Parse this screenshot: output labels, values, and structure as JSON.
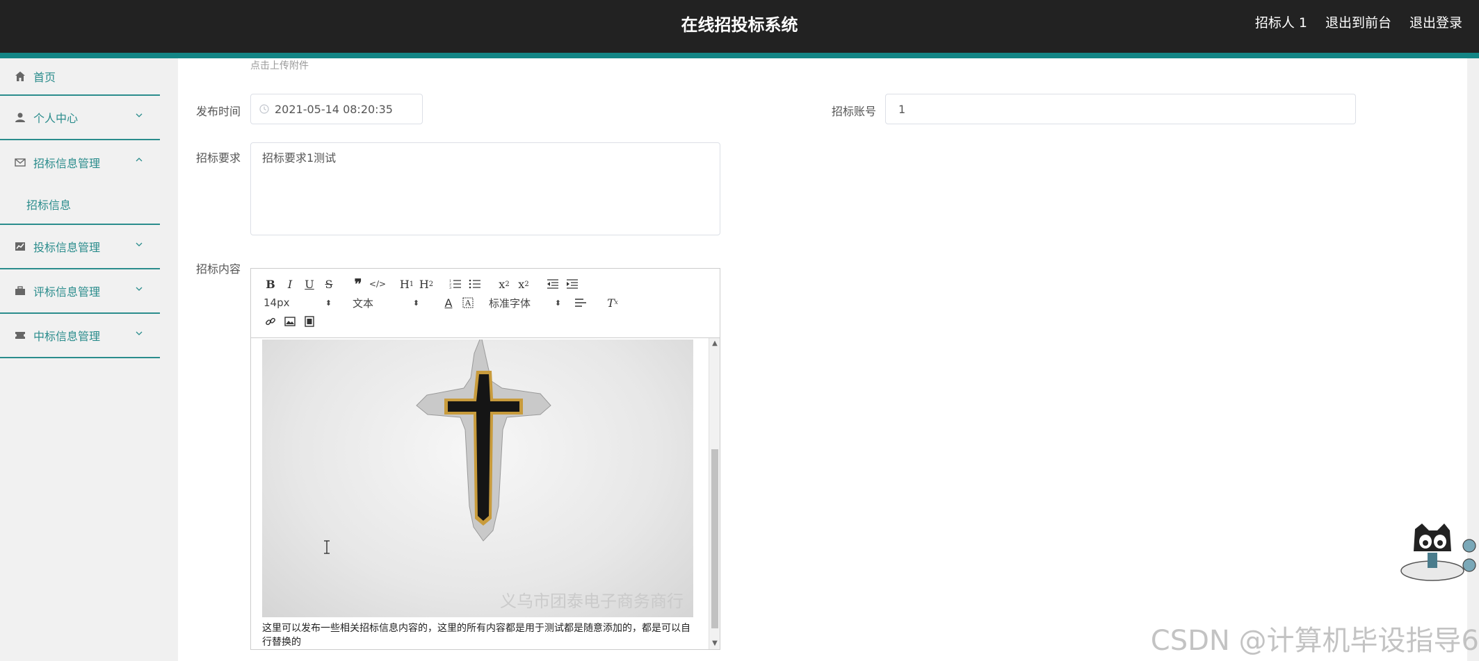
{
  "header": {
    "title": "在线招投标系统",
    "user": "招标人 1",
    "to_frontend": "退出到前台",
    "logout": "退出登录"
  },
  "sidebar": {
    "items": [
      {
        "label": "首页",
        "icon": "home-icon"
      },
      {
        "label": "个人中心",
        "icon": "user-icon"
      },
      {
        "label": "招标信息管理",
        "icon": "mail-icon",
        "expanded": true,
        "sub": [
          "招标信息"
        ]
      },
      {
        "label": "投标信息管理",
        "icon": "chart-icon"
      },
      {
        "label": "评标信息管理",
        "icon": "briefcase-icon"
      },
      {
        "label": "中标信息管理",
        "icon": "ticket-icon"
      }
    ]
  },
  "form": {
    "attach_hint": "点击上传附件",
    "publish_time_label": "发布时间",
    "publish_time_value": "2021-05-14 08:20:35",
    "account_label": "招标账号",
    "account_value": "1",
    "requirement_label": "招标要求",
    "requirement_value": "招标要求1测试",
    "content_label": "招标内容"
  },
  "editor": {
    "font_size": "14px",
    "text_type": "文本",
    "font_family": "标准字体",
    "photo_watermark": "义乌市团泰电子商务商行",
    "body_text": "这里可以发布一些相关招标信息内容的，这里的所有内容都是用于测试都是随意添加的，都是可以自行替换的"
  },
  "watermark": "CSDN @计算机毕设指导6",
  "colors": {
    "accent": "#138585",
    "topbar": "#222222",
    "sidebar_text": "#2a8c8c"
  }
}
